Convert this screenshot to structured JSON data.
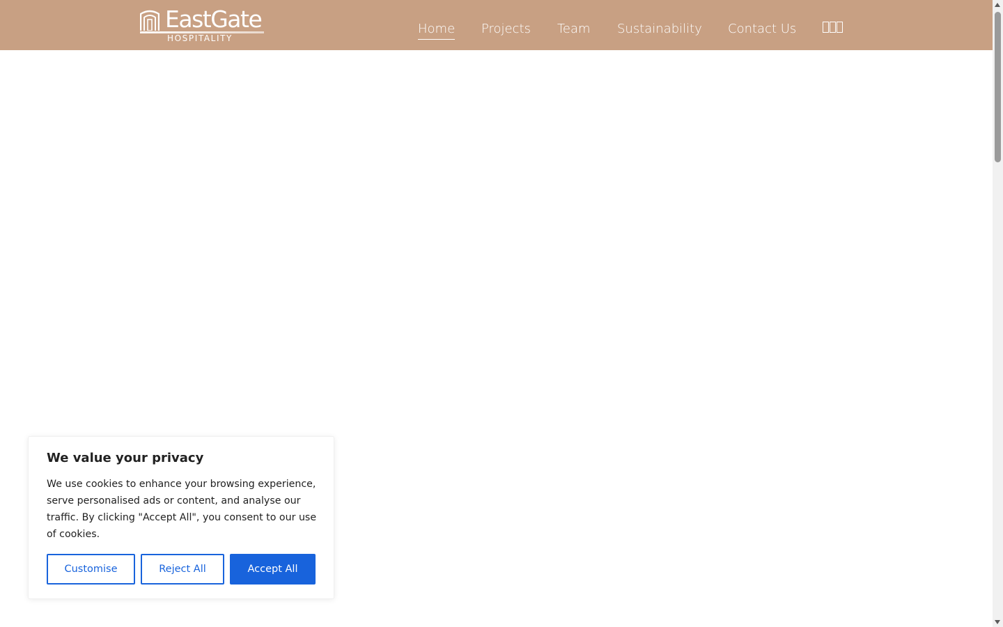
{
  "header": {
    "logo": {
      "name": "EastGate",
      "subtitle": "HOSPITALITY"
    },
    "nav": [
      {
        "label": "Home",
        "active": true
      },
      {
        "label": "Projects",
        "active": false
      },
      {
        "label": "Team",
        "active": false
      },
      {
        "label": "Sustainability",
        "active": false
      },
      {
        "label": "Contact Us",
        "active": false
      }
    ],
    "language_icon": "missing-glyph-boxes",
    "background_color": "#c8a083"
  },
  "cookie_banner": {
    "title": "We value your privacy",
    "text": "We use cookies to enhance your browsing experience, serve personalised ads or content, and analyse our traffic. By clicking \"Accept All\", you consent to our use of cookies.",
    "buttons": {
      "customise": "Customise",
      "reject": "Reject All",
      "accept": "Accept All"
    },
    "accent_color": "#1863dc"
  }
}
